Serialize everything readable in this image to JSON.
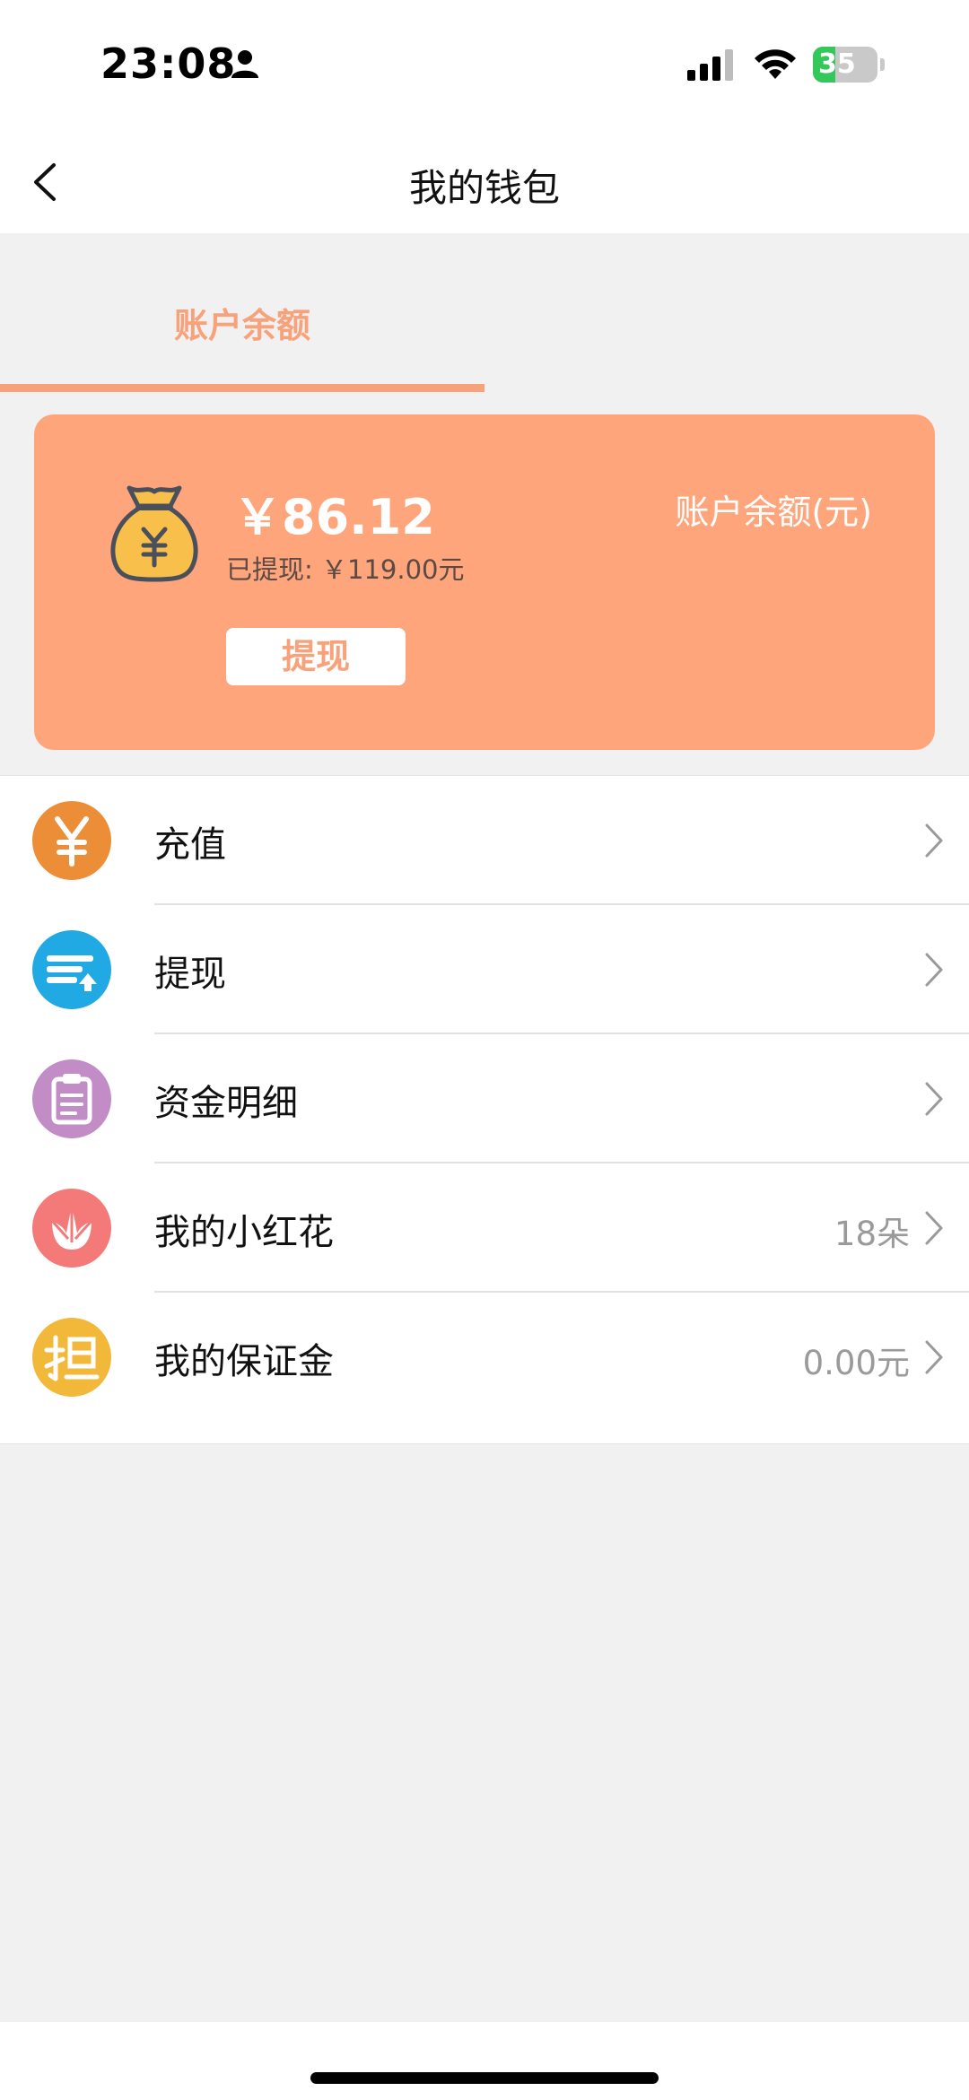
{
  "status_bar": {
    "time": "23:08",
    "battery_percent": "35",
    "battery_level": 0.35,
    "icons": [
      "person-icon",
      "signal-icon",
      "wifi-icon",
      "battery-charging-icon"
    ]
  },
  "nav": {
    "title": "我的钱包",
    "back_icon": "chevron-left-icon"
  },
  "tab": {
    "label": "账户余额"
  },
  "card": {
    "amount": "￥86.12",
    "amount_label": "账户余额(元)",
    "withdrawn_prefix": "已提现: ",
    "withdrawn_value": "￥119.00元",
    "withdraw_button": "提现",
    "icon": "money-bag-icon",
    "color": "#ffa57c"
  },
  "menu": [
    {
      "label": "充值",
      "value": "",
      "icon": "yen-icon",
      "color": "#ec8e37"
    },
    {
      "label": "提现",
      "value": "",
      "icon": "withdraw-upload-icon",
      "color": "#21a9e3"
    },
    {
      "label": "资金明细",
      "value": "",
      "icon": "clipboard-icon",
      "color": "#c28dc6"
    },
    {
      "label": "我的小红花",
      "value": "18朵",
      "icon": "flower-icon",
      "color": "#f47a7a"
    },
    {
      "label": "我的保证金",
      "value": "0.00元",
      "icon": "guarantee-dan-icon",
      "color": "#f2b83a"
    }
  ],
  "accent_color": "#f7a27a"
}
